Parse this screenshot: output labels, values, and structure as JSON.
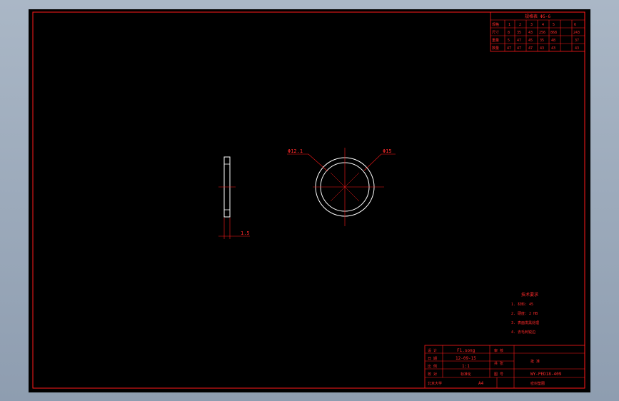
{
  "drawing": {
    "dim_inner": "Φ12.1",
    "dim_outer": "Φ15",
    "dim_thickness": "1.5"
  },
  "spec_table": {
    "title": "规格表 Φ5-6",
    "header": [
      "规格",
      "1",
      "2",
      "3",
      "4",
      "5",
      "6"
    ],
    "rows": [
      [
        "尺寸",
        "8",
        "35",
        "43",
        "256",
        "868",
        "243"
      ],
      [
        "重量",
        "5",
        "47",
        "45",
        "35",
        "48",
        "37"
      ],
      [
        "数量",
        "47",
        "47",
        "47",
        "43",
        "43",
        "43"
      ]
    ]
  },
  "notes": {
    "title": "技术要求",
    "items": [
      "1. 材料: 45",
      "2. 硬度: 2 HB",
      "3. 表面发黑处理",
      "4. 去毛刺锐边"
    ]
  },
  "title_block": {
    "designer": "F1.song",
    "date": "12-09-15",
    "scale": "1:1",
    "drawing_number": "WY-PED18-409",
    "part_name": "密封垫圈",
    "company_label": "北京大学",
    "paper_size": "A4",
    "labels": [
      "设 计",
      "日 期",
      "比 例",
      "审 核",
      "共 张",
      "第 张",
      "校 对",
      "图 号",
      "标准化",
      "批 准"
    ]
  }
}
